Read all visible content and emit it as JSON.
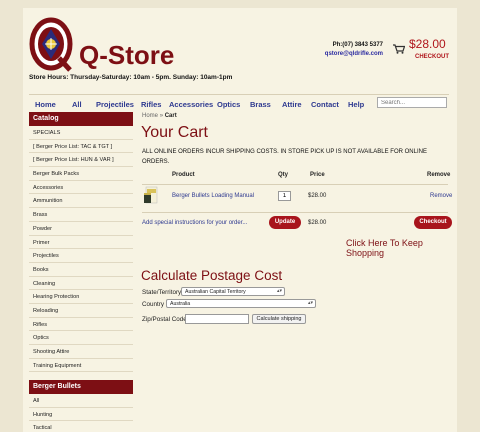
{
  "header": {
    "logo_text": "Q-Store",
    "hours": "Store Hours: Thursday-Saturday: 10am - 5pm. Sunday: 10am-1pm",
    "phone": "Ph:(07) 3843 5377",
    "email": "qstore@qldrifle.com",
    "cart_total": "$28.00",
    "checkout_label": "CHECKOUT"
  },
  "nav": {
    "items": [
      "Home",
      "All",
      "Projectiles",
      "Rifles",
      "Accessories",
      "Optics",
      "Brass",
      "Attire",
      "Contact",
      "Help"
    ],
    "search_placeholder": "Search..."
  },
  "sidebar": {
    "catalog_title": "Catalog",
    "catalog_items": [
      "SPECIALS",
      "[ Berger Price List: TAC & TGT ]",
      "[ Berger Price List: HUN & VAR ]",
      "Berger Bulk Packs",
      "Accessories",
      "Ammunition",
      "Brass",
      "Powder",
      "Primer",
      "Projectiles",
      "Books",
      "Cleaning",
      "Hearing Protection",
      "Reloading",
      "Rifles",
      "Optics",
      "Shooting Attire",
      "Training Equipment"
    ],
    "bullets_title": "Berger Bullets",
    "bullets_items": [
      "All",
      "Hunting",
      "Tactical"
    ]
  },
  "main": {
    "breadcrumb_home": "Home",
    "breadcrumb_sep": "»",
    "breadcrumb_current": "Cart",
    "title": "Your Cart",
    "notice": "ALL ONLINE ORDERS INCUR SHIPPING COSTS. IN STORE PICK UP IS NOT AVAILABLE FOR ONLINE ORDERS.",
    "columns": {
      "product": "Product",
      "qty": "Qty",
      "price": "Price",
      "remove": "Remove"
    },
    "item": {
      "name": "Berger Bullets Loading Manual",
      "qty": "1",
      "price": "$28.00",
      "remove": "Remove"
    },
    "instructions_link": "Add special instructions for your order...",
    "update_label": "Update",
    "subtotal": "$28.00",
    "checkout_label": "Checkout",
    "keep_shopping": "Click Here To Keep Shopping"
  },
  "postage": {
    "title": "Calculate Postage Cost",
    "state_label": "State/Territory",
    "state_value": "Australian Capital Territory",
    "country_label": "Country",
    "country_value": "Australia",
    "zip_label": "Zip/Postal Code",
    "calc_button": "Calculate shipping"
  },
  "colors": {
    "brand": "#7d0f14",
    "button_red": "#a8141c",
    "nav_text": "#2e3990",
    "page_bg": "#f7f3e3"
  }
}
